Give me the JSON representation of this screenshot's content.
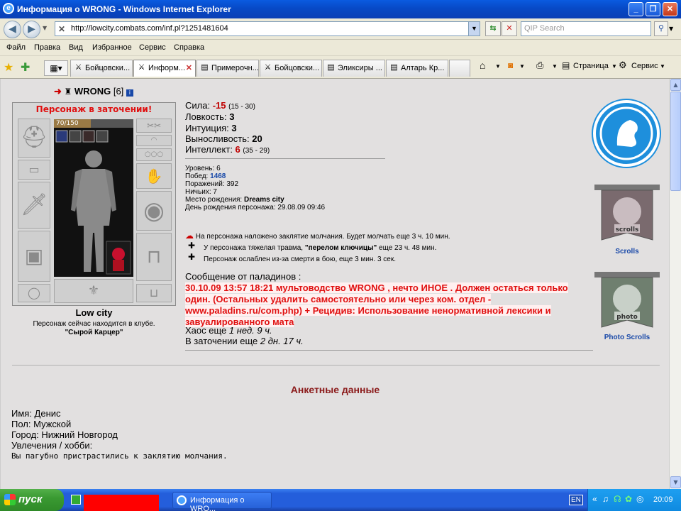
{
  "window": {
    "title": "Информация о WRONG - Windows Internet Explorer"
  },
  "address": {
    "url": "http://lowcity.combats.com/inf.pl?1251481604",
    "search_placeholder": "QIP Search"
  },
  "menu": [
    "Файл",
    "Правка",
    "Вид",
    "Избранное",
    "Сервис",
    "Справка"
  ],
  "tabs": [
    {
      "label": "Бойцовски...",
      "active": false
    },
    {
      "label": "Информ...",
      "active": true
    },
    {
      "label": "Примерочн...",
      "active": false
    },
    {
      "label": "Бойцовски...",
      "active": false
    },
    {
      "label": "Эликсиры ...",
      "active": false
    },
    {
      "label": "Алтарь Кр...",
      "active": false
    }
  ],
  "toolbar": {
    "page": "Страница",
    "service": "Сервис"
  },
  "character": {
    "name": "WRONG",
    "level_tag": "[6]",
    "prison_banner": "Персонаж в заточении!",
    "hp": "70/150",
    "hp_fraction": 0.4667,
    "city": "Low city",
    "location_text": "Персонаж сейчас находится в клубе.",
    "location_room": "\"Сырой Карцер\""
  },
  "stats": {
    "strength_label": "Сила:",
    "strength_value": "-15",
    "strength_range": "(15 - 30)",
    "agility": "Ловкость: ",
    "agility_value": "3",
    "intuition": "Интуиция: ",
    "intuition_value": "3",
    "endurance": "Выносливость: ",
    "endurance_value": "20",
    "intellect": "Интеллект: ",
    "intellect_value": "6",
    "intellect_range": "(35 - 29)"
  },
  "info": {
    "level": "Уровень: 6",
    "wins_label": "Побед: ",
    "wins": "1468",
    "losses": "Поражений: 392",
    "draws": "Ничьих: 7",
    "birthplace_label": "Место рождения: ",
    "birthplace": "Dreams city",
    "birthday": "День рождения персонажа: 29.08.09 09:46"
  },
  "effects": {
    "silence": "На персонажа наложено заклятие молчания. Будет молчать еще 3 ч. 10 мин.",
    "injury_prefix": "У персонажа тяжелая травма, ",
    "injury_bold": "\"перелом ключицы\"",
    "injury_suffix": " еще 23 ч. 48 мин.",
    "weak": "Персонаж ослаблен из-за смерти в бою, еще 3 мин. 3 сек."
  },
  "paladins": {
    "header": "Сообщение от паладинов :",
    "message": "30.10.09 13:57 18:21 мультоводство WRONG , нечто ИНОЕ . Должен остаться только один. (Остальных удалить самостоятельно или через ком. отдел - www.paladins.ru/com.php) + Рецидив: Использование ненормативной лексики и завуалированного мата",
    "chaos_label": "Хаос еще ",
    "chaos_time": "1 нед. 9 ч.",
    "prison_label": "В заточении еще ",
    "prison_time": "2 дн. 17 ч."
  },
  "side": {
    "scrolls": "Scrolls",
    "photo_scrolls": "Photo Scrolls",
    "scroll_word": "scrolls",
    "photo_word": "photo"
  },
  "profile": {
    "heading": "Анкетные данные",
    "name": "Имя: Денис",
    "gender": "Пол: Мужской",
    "city": "Город: Нижний Новгород",
    "hobby": "Увлечения / хобби:",
    "text": "Вы пагубно пристрастились к заклятию молчания."
  },
  "taskbar": {
    "start": "пуск",
    "task": "Информация о WRO...",
    "lang": "EN",
    "time": "20:09"
  },
  "colors": {
    "accent_red": "#e01010",
    "link_blue": "#1848a8",
    "taskbar_blue": "#245edb"
  }
}
